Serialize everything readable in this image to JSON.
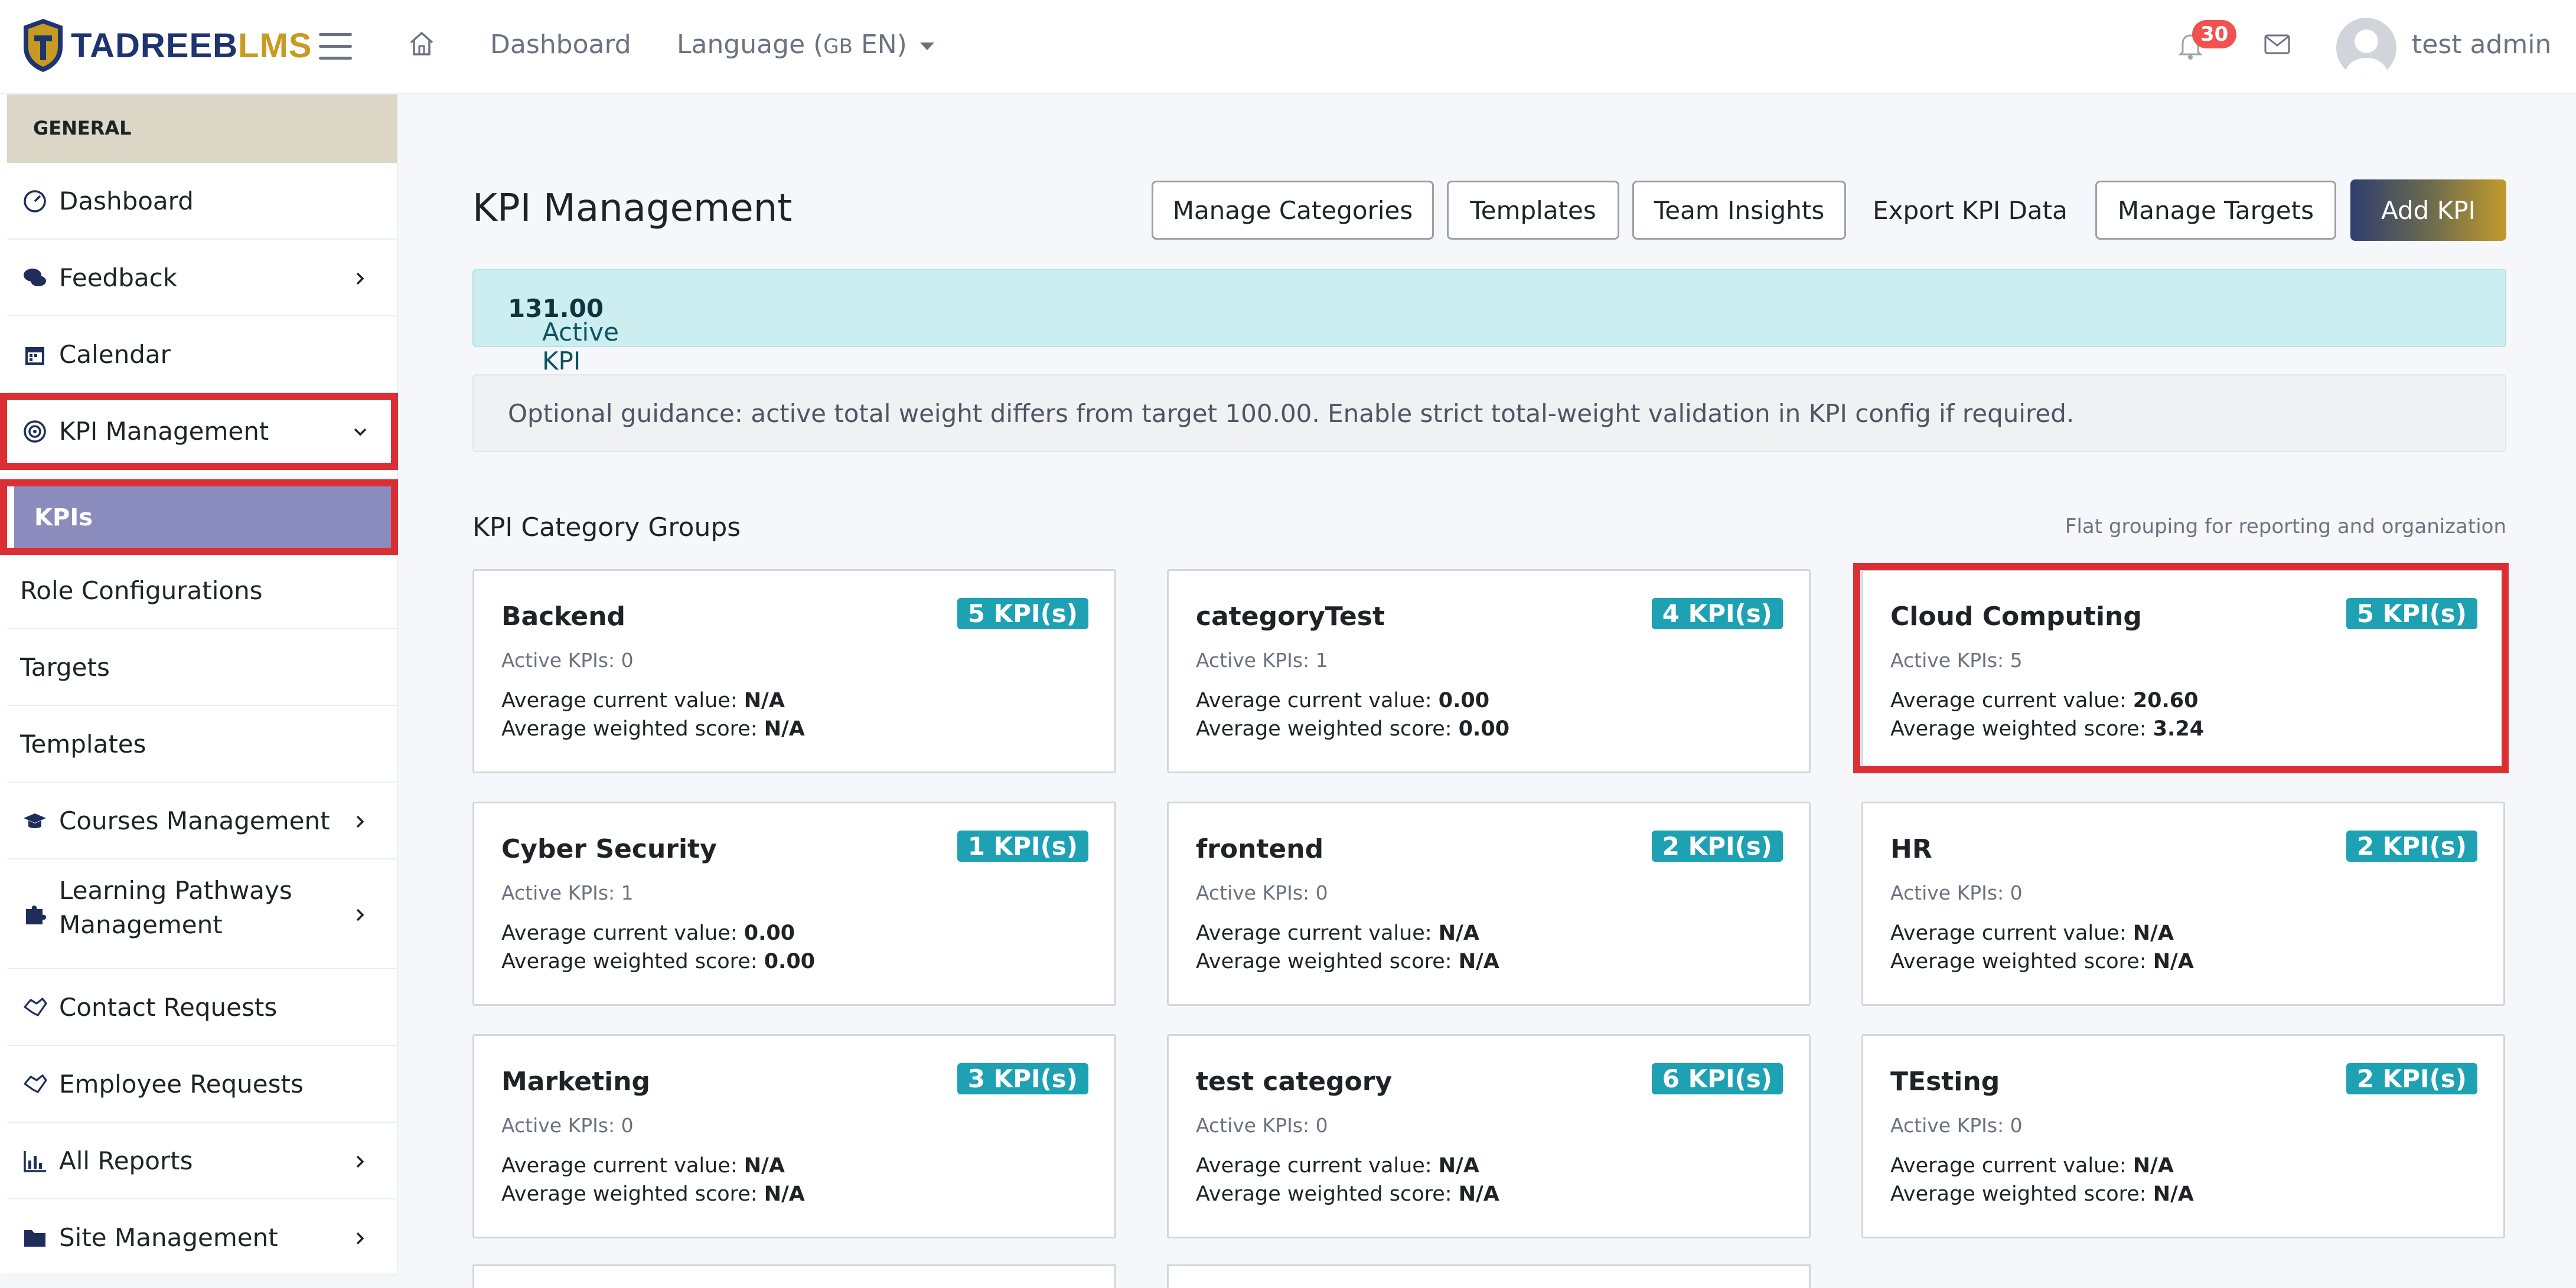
{
  "header": {
    "logo_part1": "TADREEB",
    "logo_part2": "LMS",
    "nav_dashboard": "Dashboard",
    "language_label": "Language (",
    "language_flag": "GB",
    "language_code": " EN)",
    "notification_count": "30",
    "user_name": "test admin"
  },
  "sidebar": {
    "section": "GENERAL",
    "items": [
      {
        "label": "Dashboard",
        "icon": "gauge-icon"
      },
      {
        "label": "Feedback",
        "icon": "comments-icon"
      },
      {
        "label": "Calendar",
        "icon": "calendar-icon"
      },
      {
        "label": "KPI Management",
        "icon": "target-icon"
      },
      {
        "label": "KPIs"
      },
      {
        "label": "Role Configurations"
      },
      {
        "label": "Targets"
      },
      {
        "label": "Templates"
      },
      {
        "label": "Courses Management",
        "icon": "graduation-cap-icon"
      },
      {
        "label": "Learning Pathways",
        "label2": "Management",
        "icon": "puzzle-icon"
      },
      {
        "label": "Contact Requests",
        "icon": "handshake-icon"
      },
      {
        "label": "Employee Requests",
        "icon": "handshake-icon"
      },
      {
        "label": "All Reports",
        "icon": "bar-chart-icon"
      },
      {
        "label": "Site Management",
        "icon": "folder-icon"
      }
    ]
  },
  "main": {
    "title": "KPI Management",
    "buttons": {
      "manage_categories": "Manage Categories",
      "templates": "Templates",
      "team_insights": "Team Insights",
      "export": "Export KPI Data",
      "manage_targets": "Manage Targets",
      "add_kpi": "Add KPI"
    },
    "info_label": "Active KPI total weight: ",
    "info_value": "131.00",
    "guidance": "Optional guidance: active total weight differs from target 100.00. Enable strict total-weight validation in KPI config if required.",
    "section_title": "KPI Category Groups",
    "section_note": "Flat grouping for reporting and organization",
    "avg_value_label": "Average current value: ",
    "avg_score_label": "Average weighted score: ",
    "cards": [
      {
        "name": "Backend",
        "badge": "5 KPI(s)",
        "active": "Active KPIs: 0",
        "avg_value": "N/A",
        "avg_score": "N/A"
      },
      {
        "name": "categoryTest",
        "badge": "4 KPI(s)",
        "active": "Active KPIs: 1",
        "avg_value": "0.00",
        "avg_score": "0.00"
      },
      {
        "name": "Cloud Computing",
        "badge": "5 KPI(s)",
        "active": "Active KPIs: 5",
        "avg_value": "20.60",
        "avg_score": "3.24"
      },
      {
        "name": "Cyber Security",
        "badge": "1 KPI(s)",
        "active": "Active KPIs: 1",
        "avg_value": "0.00",
        "avg_score": "0.00"
      },
      {
        "name": "frontend",
        "badge": "2 KPI(s)",
        "active": "Active KPIs: 0",
        "avg_value": "N/A",
        "avg_score": "N/A"
      },
      {
        "name": "HR",
        "badge": "2 KPI(s)",
        "active": "Active KPIs: 0",
        "avg_value": "N/A",
        "avg_score": "N/A"
      },
      {
        "name": "Marketing",
        "badge": "3 KPI(s)",
        "active": "Active KPIs: 0",
        "avg_value": "N/A",
        "avg_score": "N/A"
      },
      {
        "name": "test category",
        "badge": "6 KPI(s)",
        "active": "Active KPIs: 0",
        "avg_value": "N/A",
        "avg_score": "N/A"
      },
      {
        "name": "TEsting",
        "badge": "2 KPI(s)",
        "active": "Active KPIs: 0",
        "avg_value": "N/A",
        "avg_score": "N/A"
      }
    ]
  },
  "colors": {
    "highlight": "#dc2f34",
    "badge": "#1da1b3",
    "active_subitem": "#8a8cbd",
    "brand_navy": "#1e3470",
    "brand_gold": "#c99a22"
  }
}
